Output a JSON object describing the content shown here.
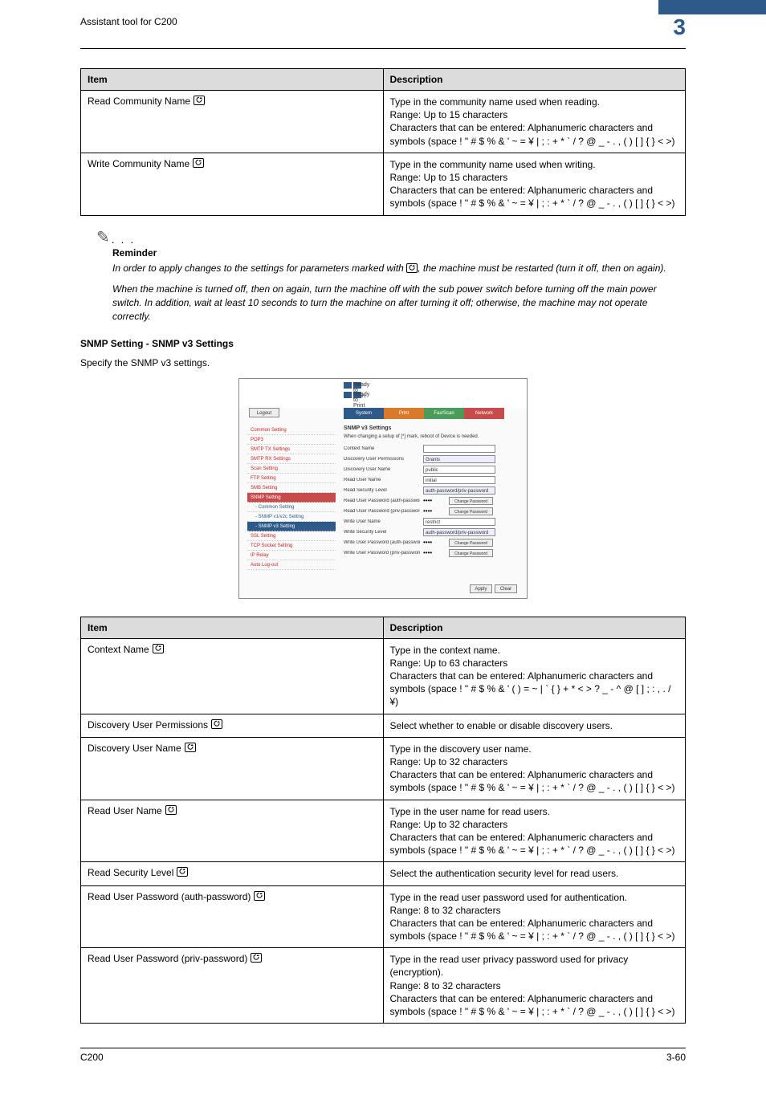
{
  "header": {
    "tool": "Assistant tool for C200",
    "chapter": "3"
  },
  "table1": {
    "head": {
      "item": "Item",
      "desc": "Description"
    },
    "rows": [
      {
        "item": "Read Community Name",
        "d1": "Type in the community name used when reading.",
        "d2": "Range: Up to 15 characters",
        "d3": "Characters that can be entered: Alphanumeric characters and symbols (space ! \" # $ % & ' ~ = ¥ | ; : + * ` / ? @ _ - . , ( ) [ ] { } < >)"
      },
      {
        "item": "Write Community Name",
        "d1": "Type in the community name used when writing.",
        "d2": "Range: Up to 15 characters",
        "d3": "Characters that can be entered: Alphanumeric characters and symbols (space ! \" # $ % & ' ~ = ¥ | ; : + * ` / ? @ _ - . , ( ) [ ] { } < >)"
      }
    ]
  },
  "reminder": {
    "label": "Reminder",
    "p1": "In order to apply changes to the settings for parameters marked with",
    "p1b": ", the machine must be restarted (turn it off, then on again).",
    "p2": "When the machine is turned off, then on again, turn the machine off with the sub power switch before turning off the main power switch. In addition, wait at least 10 seconds to turn the machine on after turning it off; otherwise, the machine may not operate correctly."
  },
  "section": {
    "title": "SNMP Setting - SNMP v3 Settings",
    "intro": "Specify the SNMP v3 settings."
  },
  "shot": {
    "ready1": "Ready to scan.",
    "ready2": "Ready to Print",
    "logout": "Logout",
    "tabs": {
      "sys": "System",
      "print": "Print",
      "fax": "Fax/Scan",
      "net": "Network"
    },
    "side": [
      "Common Setting",
      "POP3",
      "SMTP TX Settings",
      "SMTP RX Settings",
      "Scan Setting",
      "FTP Setting",
      "SMB Setting",
      "SNMP Setting",
      "- Common Setting",
      "- SNMP v1/v2c Setting",
      "- SNMP v3 Setting",
      "SSL Setting",
      "TCP Socket Setting",
      "IP Relay",
      "Auto Log-out"
    ],
    "main": {
      "title": "SNMP v3 Settings",
      "note": "When changing a setup of [*] mark, reboot of Device is needed.",
      "contextName": "Context Name",
      "discPerm": "Discovery User Permissions",
      "discPermVal": "Grants",
      "discName": "Discovery User Name",
      "discNameVal": "public",
      "readName": "Read User Name",
      "readNameVal": "initial",
      "readSec": "Read Security Level",
      "readSecVal": "auth-password/priv-password",
      "readAuth": "Read User Password (auth-password)",
      "readPriv": "Read User Password (priv-password)",
      "writeName": "Write User Name",
      "writeNameVal": "restrict",
      "writeSec": "Write Security Level",
      "writeSecVal": "auth-password/priv-password",
      "writeAuth": "Write User Password (auth-password)",
      "writePriv": "Write User Password (priv-password)",
      "change": "Change Password",
      "apply": "Apply",
      "clear": "Clear"
    }
  },
  "table2": {
    "head": {
      "item": "Item",
      "desc": "Description"
    },
    "rows": [
      {
        "item": "Context Name",
        "d1": "Type in the context name.",
        "d2": "Range: Up to 63 characters",
        "d3": "Characters that can be entered: Alphanumeric characters and symbols (space ! \" # $ % & ' ( ) = ~ | ` { } + * < > ? _ - ^ @ [ ] ; : , . / ¥)"
      },
      {
        "item": "Discovery User Permissions",
        "d1": "Select whether to enable or disable discovery users."
      },
      {
        "item": "Discovery User Name",
        "d1": "Type in the discovery user name.",
        "d2": "Range: Up to 32 characters",
        "d3": "Characters that can be entered: Alphanumeric characters and symbols (space ! \" # $ % & ' ~ = ¥ | ; : + * ` / ? @ _ - . , ( ) [ ] { } < >)"
      },
      {
        "item": "Read User Name",
        "d1": "Type in the user name for read users.",
        "d2": "Range: Up to 32 characters",
        "d3": "Characters that can be entered: Alphanumeric characters and symbols (space ! \" # $ % & ' ~ = ¥ | ; : + * ` / ? @ _ - . , ( ) [ ] { } < >)"
      },
      {
        "item": "Read Security Level",
        "d1": "Select the authentication security level for read users."
      },
      {
        "item": "Read User Password (auth-password)",
        "d1": "Type in the read user password used for authentication.",
        "d2": "Range: 8 to 32 characters",
        "d3": "Characters that can be entered: Alphanumeric characters and symbols (space ! \" # $ % & ' ~ = ¥ | ; : + * ` / ? @ _ - . , ( ) [ ] { } < >)"
      },
      {
        "item": "Read User Password (priv-password)",
        "d1": "Type in the read user privacy password used for privacy (encryption).",
        "d2": "Range: 8 to 32 characters",
        "d3": "Characters that can be entered: Alphanumeric characters and symbols (space ! \" # $ % & ' ~ = ¥ | ; : + * ` / ? @ _ - . , ( ) [ ] { } < >)"
      }
    ]
  },
  "footer": {
    "left": "C200",
    "right": "3-60"
  }
}
